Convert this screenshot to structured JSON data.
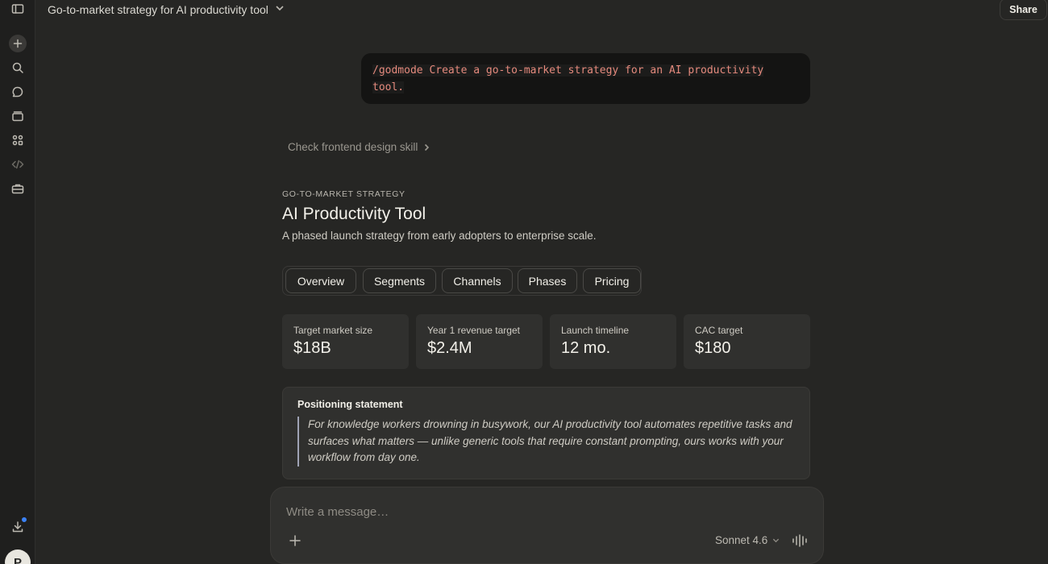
{
  "header": {
    "title": "Go-to-market strategy for AI productivity tool",
    "share_label": "Share"
  },
  "sidebar": {
    "icons": [
      "sidebar-toggle-icon",
      "new-chat-icon",
      "search-icon",
      "chats-icon",
      "projects-icon",
      "artifacts-icon",
      "code-icon",
      "toolbox-icon",
      "download-icon"
    ],
    "avatar_initial": "P"
  },
  "conversation": {
    "user_message": "/godmode Create a go-to-market strategy for an AI productivity tool.",
    "skill_check": "Check frontend design skill"
  },
  "artifact": {
    "eyebrow": "GO-TO-MARKET STRATEGY",
    "title": "AI Productivity Tool",
    "subtitle": "A phased launch strategy from early adopters to enterprise scale.",
    "tabs": [
      "Overview",
      "Segments",
      "Channels",
      "Phases",
      "Pricing"
    ],
    "stats": [
      {
        "label": "Target market size",
        "value": "$18B"
      },
      {
        "label": "Year 1 revenue target",
        "value": "$2.4M"
      },
      {
        "label": "Launch timeline",
        "value": "12 mo."
      },
      {
        "label": "CAC target",
        "value": "$180"
      }
    ],
    "positioning": {
      "title": "Positioning statement",
      "quote": "For knowledge workers drowning in busywork, our AI productivity tool automates repetitive tasks and surfaces what matters — unlike generic tools that require constant prompting, ours works with your workflow from day one."
    }
  },
  "composer": {
    "placeholder": "Write a message…",
    "model": "Sonnet 4.6"
  },
  "colors": {
    "background": "#262624",
    "sidebar": "#1f1f1e",
    "card": "#30302e",
    "code_text": "#e58a7d",
    "quote_border": "#9fa3b5",
    "notification_dot": "#3b82f6"
  }
}
